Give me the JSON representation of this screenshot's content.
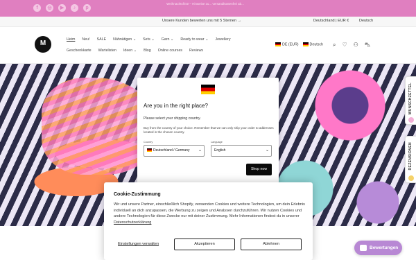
{
  "announcement": {
    "social_icons": [
      "facebook-icon",
      "instagram-icon",
      "youtube-icon",
      "tiktok-icon",
      "pinterest-icon"
    ],
    "message": "Weihnachtsfrist! – Hinweise zu... versandkostenfrei ab...",
    "bg_color": "#e07fc0"
  },
  "subbar": {
    "reviews_text": "Unsere Kunden bewerten uns mit 5 Sternen →",
    "country": "Deutschland | EUR €",
    "language": "Deutsch"
  },
  "header": {
    "logo_text": "M",
    "nav_row1": [
      "Heim",
      "Neu!",
      "SALE",
      "Nähnätigen ⌄",
      "Sets ⌄",
      "Garn ⌄",
      "Ready to wear ⌄",
      "Jewellery"
    ],
    "nav_row2": [
      "Geschenkkarte",
      "Wartelisten",
      "Ideen ⌄",
      "Blog",
      "Online courses",
      "Reviews"
    ],
    "currency_selector": "DE (EUR)",
    "language_selector": "Deutsch",
    "icons": [
      "search-icon",
      "heart-icon",
      "account-icon",
      "cart-icon"
    ],
    "cart_count": "0"
  },
  "side_tabs": {
    "wishlist": "WUNSCHZETTEL",
    "reviews": "REZENSIONEN"
  },
  "country_modal": {
    "title": "Are you in the right place?",
    "subtitle": "Please select your shipping country.",
    "body": "Buy from the country of your choice. Remember that we can only ship your order to addresses located in the chosen country.",
    "country_label": "Country",
    "country_value": "Deutschland / Germany",
    "language_label": "Language",
    "language_value": "English",
    "shop_button": "Shop now"
  },
  "cookie_banner": {
    "title": "Cookie-Zustimmung",
    "text": "Wir und unsere Partner, einschließlich Shopify, verwenden Cookies und weitere Technologien, um dein Erlebnis individuell an dich anzupassen, die Werbung zu zeigen und Analysen durchzuführen. Wir nutzen Cookies und andere Technologien für diese Zwecke nur mit deiner Zustimmung. Mehr Informationen findest du in unserer",
    "privacy_link": "Datenschutzerklärung",
    "settings_link": "Einstellungen verwalten",
    "accept_button": "Akzeptieren",
    "reject_button": "Ablehnen"
  },
  "reviews_button": {
    "label": "Bewertungen",
    "color": "#b888d4"
  }
}
